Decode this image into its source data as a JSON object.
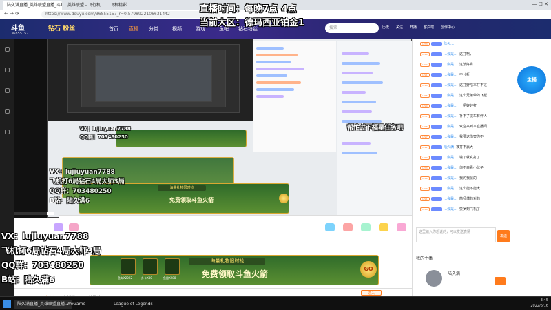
{
  "browser": {
    "tabs": [
      "陆久满直播_英雄联盟直播_斗鱼...",
      "英雄联盟 - 飞行机...",
      "飞机精彩..."
    ],
    "url": "https://www.douyu.com/36855157_r=0.5798922106631442"
  },
  "header": {
    "logo": "斗鱼",
    "room_number": "36855157",
    "nav": [
      "首页",
      "直播",
      "分类",
      "视频",
      "游戏",
      "鱼吧",
      "钻石粉丝"
    ],
    "brand_badge": "钻石 粉丝",
    "search_placeholder": "搜索",
    "icons": [
      "历史",
      "关注",
      "开播",
      "客户端",
      "创作中心"
    ]
  },
  "overlay": {
    "broadcast_time": "直播时间：每晚7点-4点",
    "region": "当前大区：德玛西亚铂金1",
    "stream_info": [
      "VX：lujiuyuan7788",
      "飞机打6局钻石4局大师3局",
      "QQ群：703480250",
      "B站：陆久满6"
    ],
    "help_text": "帮忙过下福星任务吧"
  },
  "promo_banner": {
    "title": "海量礼物限时抢",
    "cta": "免费领取斗鱼火箭",
    "items": [
      "鱼丸X2022",
      "办卡X30",
      "鱼翅X288",
      "飞机X2",
      "火箭X1"
    ],
    "badge": "GO"
  },
  "tabs_bottom": [
    "热议",
    "主播说",
    "相关推荐"
  ],
  "chat": {
    "messages": [
      {
        "lv": "LV33",
        "user": "陆久…",
        "text": ""
      },
      {
        "lv": "LV29",
        "user": "…会是…",
        "text": "这打啊，"
      },
      {
        "lv": "LV24",
        "user": "…会是…",
        "text": "这波好秀"
      },
      {
        "lv": "LV21",
        "user": "…会是…",
        "text": "不分析"
      },
      {
        "lv": "LV28",
        "user": "…会是…",
        "text": "这打野啥本打不过"
      },
      {
        "lv": "LV16",
        "user": "…会是…",
        "text": "这个兄弟带的飞起"
      },
      {
        "lv": "LV20",
        "user": "…会是…",
        "text": "一把好好打"
      },
      {
        "lv": "LV31",
        "user": "…会是…",
        "text": "补不了提车有伴人"
      },
      {
        "lv": "LV38",
        "user": "…会是…",
        "text": "欢迎来到本直播间"
      },
      {
        "lv": "LV27",
        "user": "…会是…",
        "text": "我要这伤害你不"
      },
      {
        "lv": "LV22",
        "user": "陆久满",
        "text": "被打不赢大"
      },
      {
        "lv": "LV30",
        "user": "…会是…",
        "text": "输了就真打了"
      },
      {
        "lv": "LV33",
        "user": "…会是…",
        "text": "你不来看小伙子"
      },
      {
        "lv": "LV19",
        "user": "…会是…",
        "text": "我的我就的"
      },
      {
        "lv": "LV23",
        "user": "…会是…",
        "text": "这个能不能大"
      },
      {
        "lv": "LV21",
        "user": "…会是…",
        "text": "简师傅的对的"
      },
      {
        "lv": "LV18",
        "user": "…会是…",
        "text": "赞罗到飞机了"
      }
    ],
    "input_placeholder": "这里输入你想说的，可以发送表情",
    "send_label": "发送",
    "follow_label": "我的主播",
    "streamer_name": "陆久满"
  },
  "taskbar": {
    "items": [
      "陆久满直播_英雄联盟直播...",
      "WeGame",
      "League of Legends"
    ],
    "time": "3:45",
    "date": "2022/6/16"
  }
}
